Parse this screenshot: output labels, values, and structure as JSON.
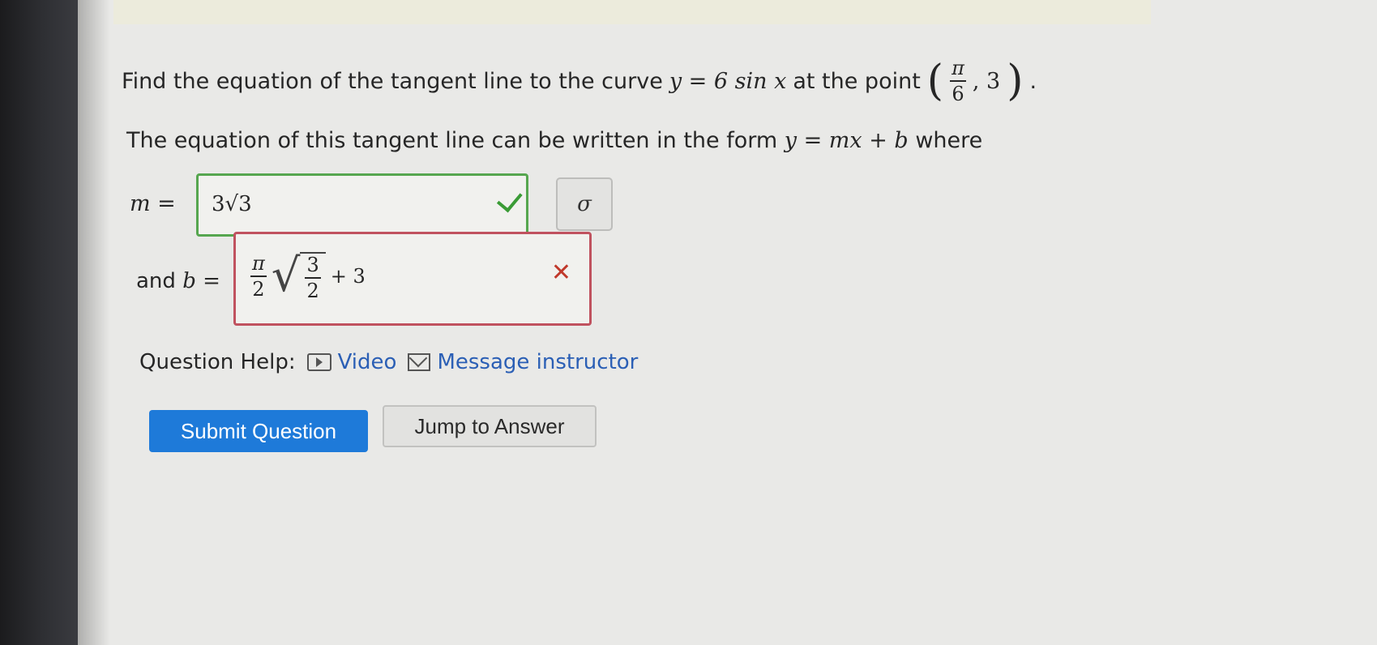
{
  "question": {
    "prefix": "Find the equation of the tangent line to the curve",
    "curve": "y = 6 sin x",
    "mid": "at the point",
    "point_num": "π",
    "point_den": "6",
    "point_y": ", 3",
    "end": "."
  },
  "form": {
    "text": "The equation of this tangent line can be written in the form",
    "eq": "y = mx + b",
    "where": "where"
  },
  "m_field": {
    "label": "m =",
    "value": "3√3",
    "status": "correct"
  },
  "key_button": {
    "label": "σ"
  },
  "b_field": {
    "label_prefix": "and",
    "label_var": "b =",
    "frac_num": "π",
    "frac_den": "2",
    "root_num": "3",
    "root_den": "2",
    "tail": "+ 3",
    "status": "incorrect"
  },
  "help": {
    "label": "Question Help:",
    "video": "Video",
    "message": "Message instructor"
  },
  "buttons": {
    "submit": "Submit Question",
    "jump": "Jump to Answer"
  },
  "colors": {
    "correct": "#56a64f",
    "incorrect": "#c0525f",
    "primary": "#1e7ad9",
    "link": "#2b5fb5"
  }
}
